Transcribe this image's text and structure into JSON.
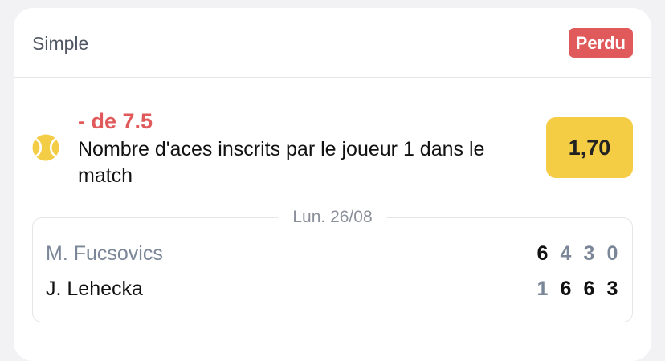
{
  "ticket": {
    "bet_type": "Simple",
    "status": "Perdu"
  },
  "selection": {
    "sport_icon": "tennis-ball-icon",
    "pick": "- de 7.5",
    "market": "Nombre d'aces inscrits par le joueur 1 dans le match",
    "odds": "1,70"
  },
  "match": {
    "date": "Lun. 26/08",
    "players": [
      {
        "name": "M. Fucsovics",
        "sets": [
          "6",
          "4",
          "3",
          "0"
        ]
      },
      {
        "name": "J. Lehecka",
        "sets": [
          "1",
          "6",
          "6",
          "3"
        ]
      }
    ]
  },
  "colors": {
    "status_lost": "#e05a5b",
    "odds_bg": "#f5cd45",
    "muted_text": "#7b8798",
    "tennis_ball": "#f3cd45"
  }
}
